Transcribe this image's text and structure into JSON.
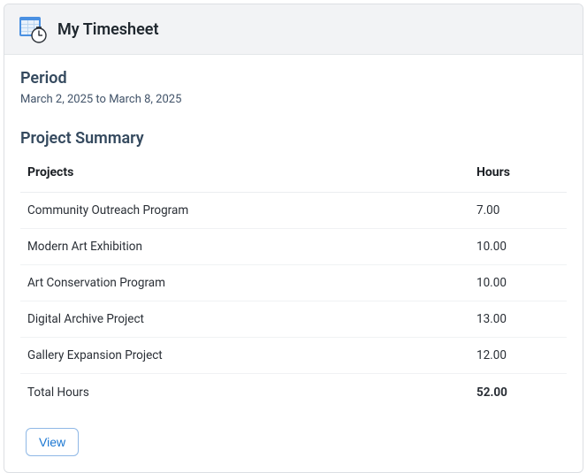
{
  "header": {
    "title": "My Timesheet"
  },
  "period": {
    "heading": "Period",
    "range": "March 2, 2025 to March 8, 2025"
  },
  "summary": {
    "heading": "Project Summary",
    "columns": {
      "project": "Projects",
      "hours": "Hours"
    },
    "rows": [
      {
        "project": "Community Outreach Program",
        "hours": "7.00"
      },
      {
        "project": "Modern Art Exhibition",
        "hours": "10.00"
      },
      {
        "project": "Art Conservation Program",
        "hours": "10.00"
      },
      {
        "project": "Digital Archive Project",
        "hours": "13.00"
      },
      {
        "project": "Gallery Expansion Project",
        "hours": "12.00"
      }
    ],
    "total": {
      "label": "Total Hours",
      "hours": "52.00"
    }
  },
  "actions": {
    "view": "View"
  }
}
